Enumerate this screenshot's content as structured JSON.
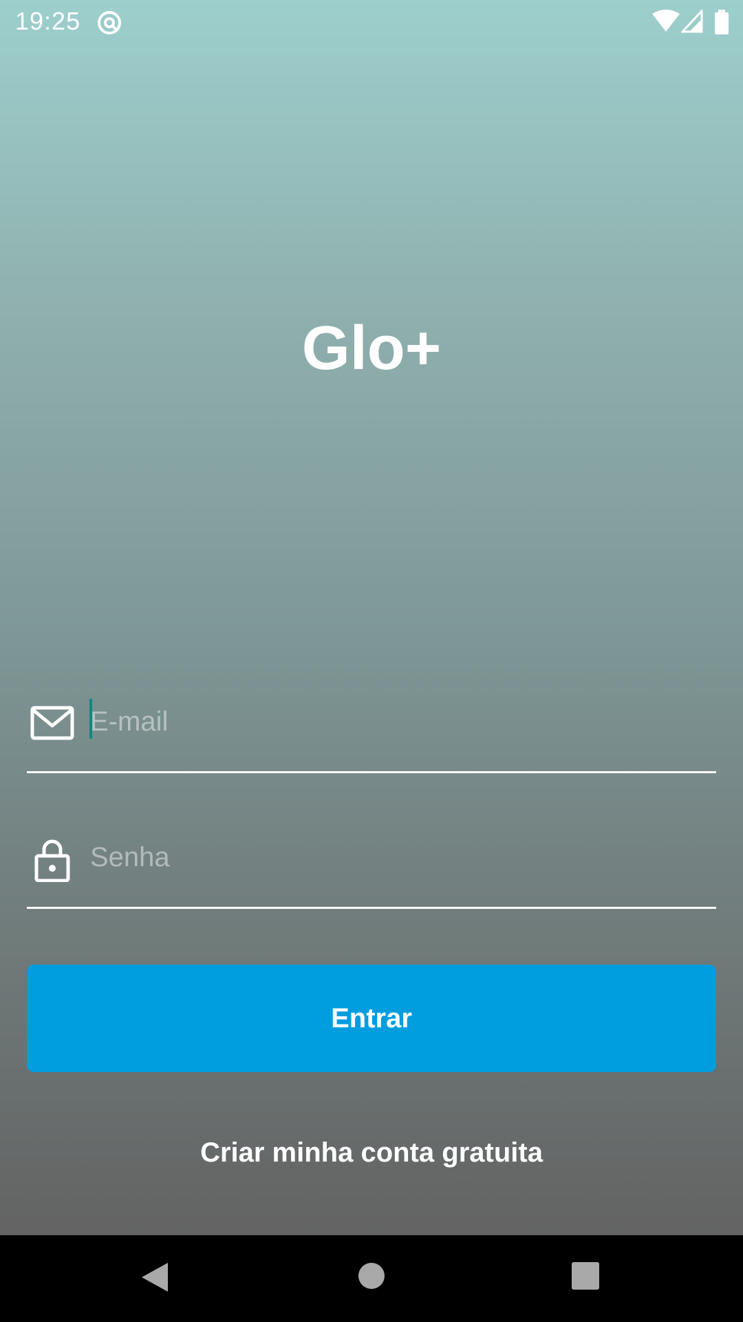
{
  "status_bar": {
    "time": "19:25",
    "icons": [
      "notification-icon",
      "wifi-icon",
      "signal-icon",
      "battery-icon"
    ]
  },
  "app": {
    "title": "Glo+"
  },
  "form": {
    "email": {
      "placeholder": "E-mail",
      "value": "",
      "icon": "mail-icon"
    },
    "password": {
      "placeholder": "Senha",
      "value": "",
      "icon": "lock-icon"
    },
    "login_button": "Entrar",
    "signup_link": "Criar minha conta gratuita"
  },
  "colors": {
    "primary_button": "#009ede",
    "cursor": "#0b8a80",
    "gradient_top": "#9dcfcd",
    "gradient_bottom": "#636363"
  },
  "nav_bar": {
    "icons": [
      "back-icon",
      "home-icon",
      "recents-icon"
    ]
  }
}
